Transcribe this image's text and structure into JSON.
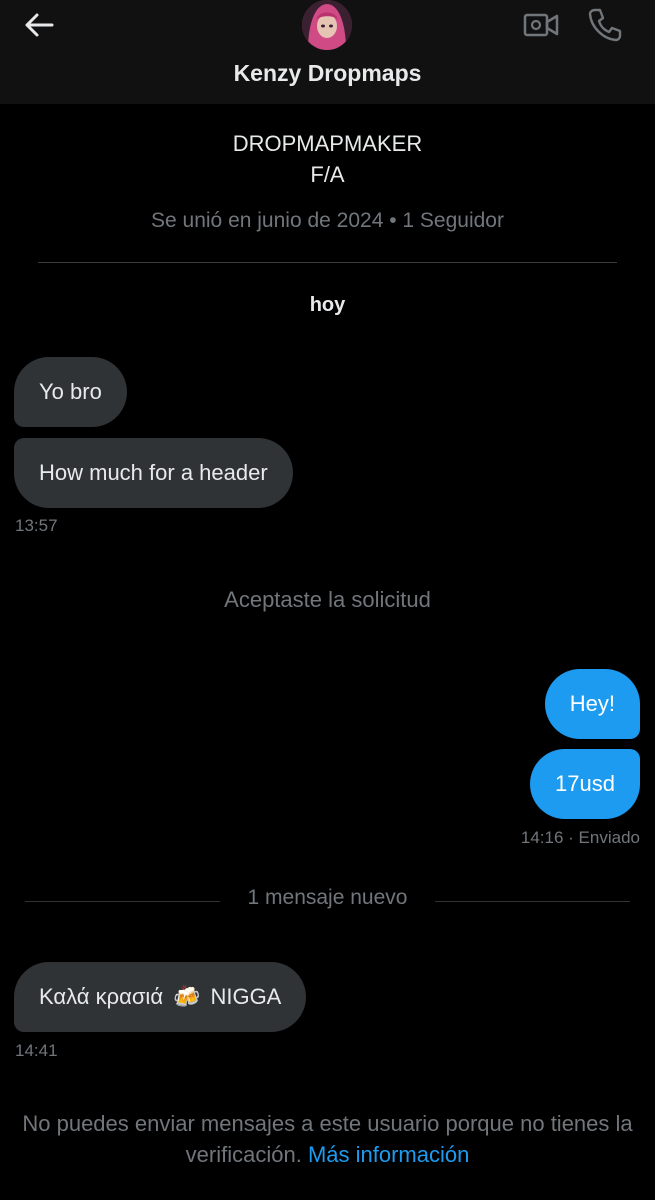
{
  "header": {
    "title": "Kenzy Dropmaps",
    "back_icon": "arrow-left-icon",
    "video_icon": "video-call-icon",
    "call_icon": "phone-icon"
  },
  "profile": {
    "bio_line1": "DROPMAPMAKER",
    "bio_line2": "F/A",
    "meta": "Se unió en junio de 2024 • 1 Seguidor"
  },
  "conversation": {
    "date_separator": "hoy",
    "incoming_group1": {
      "messages": [
        "Yo bro",
        "How much for a header"
      ],
      "time": "13:57"
    },
    "system_message": "Aceptaste la solicitud",
    "outgoing_group": {
      "messages": [
        "Hey!",
        "17usd"
      ],
      "time": "14:16",
      "status": "· Enviado"
    },
    "new_messages_label": "1 mensaje nuevo",
    "incoming_group2": {
      "message_text_before": "Καλά κρασιά",
      "message_emoji": "🍻",
      "message_text_after": "NIGGA",
      "time": "14:41"
    }
  },
  "footer": {
    "notice": "No puedes enviar mensajes a este usuario porque no tienes la verificación.",
    "link": "Más información"
  },
  "colors": {
    "background": "#000000",
    "header_bg": "#111111",
    "incoming_bubble": "#2f3336",
    "outgoing_bubble": "#1d9bf0",
    "secondary_text": "#71767b",
    "link": "#1d9bf0"
  }
}
